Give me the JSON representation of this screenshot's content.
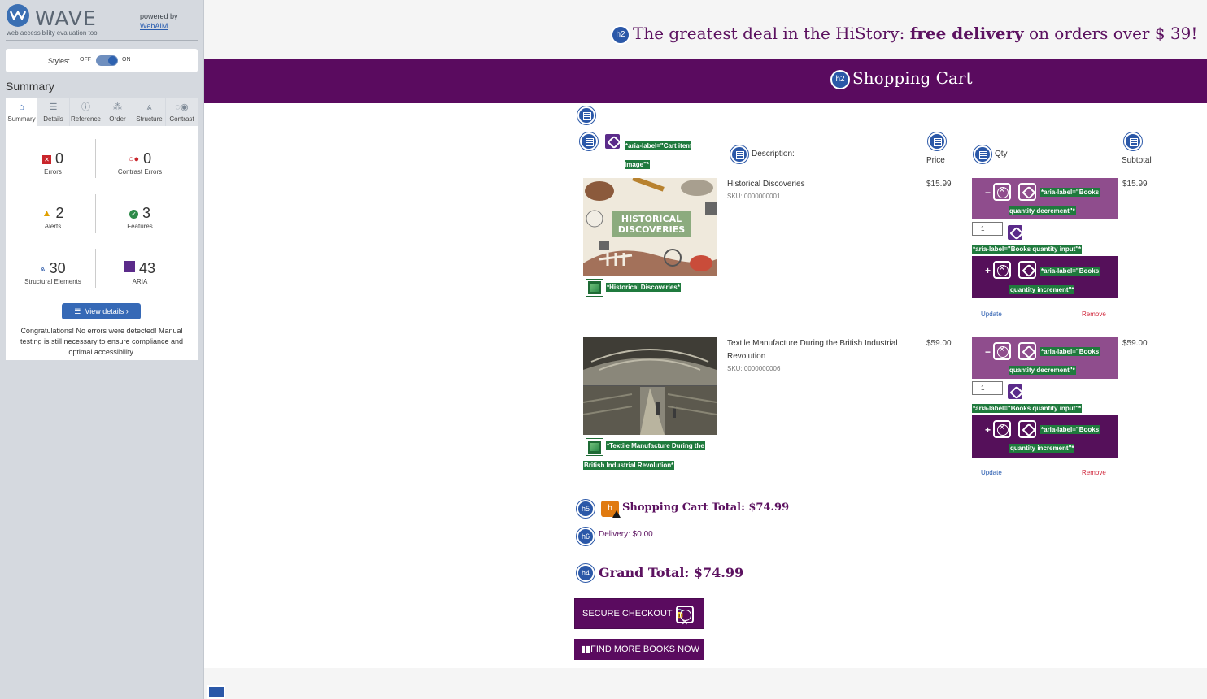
{
  "wave": {
    "logo_text": "WAVE",
    "tagline": "web accessibility evaluation tool",
    "powered_by": "powered by",
    "webaim_link": "WebAIM",
    "styles_label": "Styles:",
    "styles_off": "OFF",
    "styles_on": "ON",
    "summary_title": "Summary",
    "tabs": [
      {
        "label": "Summary",
        "icon": "home-icon"
      },
      {
        "label": "Details",
        "icon": "list-icon"
      },
      {
        "label": "Reference",
        "icon": "info-icon"
      },
      {
        "label": "Order",
        "icon": "order-icon"
      },
      {
        "label": "Structure",
        "icon": "structure-icon"
      },
      {
        "label": "Contrast",
        "icon": "contrast-icon"
      }
    ],
    "stats": {
      "errors": {
        "count": "0",
        "label": "Errors"
      },
      "contrast_errors": {
        "count": "0",
        "label": "Contrast Errors"
      },
      "alerts": {
        "count": "2",
        "label": "Alerts"
      },
      "features": {
        "count": "3",
        "label": "Features"
      },
      "structural": {
        "count": "30",
        "label": "Structural Elements"
      },
      "aria": {
        "count": "43",
        "label": "ARIA"
      }
    },
    "view_details": "View details ›",
    "congrats": "Congratulations! No errors were detected! Manual testing is still necessary to ensure compliance and optimal accessibility."
  },
  "page": {
    "promo": {
      "prefix": "The greatest deal in the HiStory: ",
      "bold": "free delivery",
      "suffix": " on orders over $ 39!"
    },
    "banner_title": "Shopping Cart",
    "heading_icon": "h2",
    "table": {
      "col_image_label": "*aria-label=\"Cart item image\"*",
      "col_description": "Description:",
      "col_price": "Price",
      "col_qty": "Qty",
      "col_subtotal": "Subtotal"
    },
    "items": [
      {
        "title": "Historical Discoveries",
        "sku": "SKU: 0000000001",
        "price": "$15.99",
        "qty": "1",
        "subtotal": "$15.99",
        "img_alt_label": "*Historical Discoveries*",
        "img_text": "HISTORICAL DISCOVERIES"
      },
      {
        "title": "Textile Manufacture During the British Industrial Revolution",
        "sku": "SKU: 0000000006",
        "price": "$59.00",
        "qty": "1",
        "subtotal": "$59.00",
        "img_alt_label": "*Textile Manufacture During the British Industrial Revolution*"
      }
    ],
    "qty_labels": {
      "decrement": "*aria-label=\"Books quantity decrement\"*",
      "input": "*aria-label=\"Books quantity input\"*",
      "increment": "*aria-label=\"Books quantity increment\"*",
      "minus": "−",
      "plus": "+",
      "update": "Update",
      "remove": "Remove"
    },
    "totals": {
      "h5": "h5",
      "h6": "h6",
      "h4": "h4",
      "alert_glyph": "h",
      "cart_total": "Shopping Cart Total: $74.99",
      "delivery": "Delivery: $0.00",
      "grand_total": "Grand Total: $74.99"
    },
    "buttons": {
      "checkout": "SECURE CHECKOUT",
      "find_more": "FIND MORE BOOKS NOW"
    }
  }
}
